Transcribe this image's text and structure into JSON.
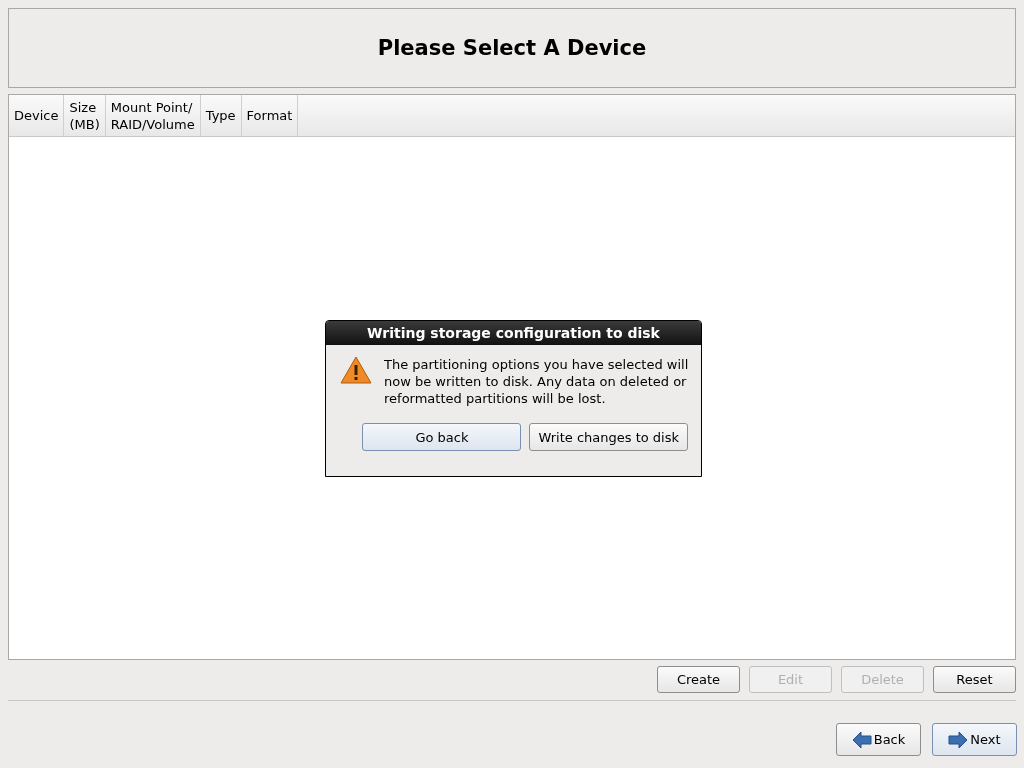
{
  "header": {
    "title": "Please Select A Device"
  },
  "table": {
    "columns": [
      {
        "label": "Device"
      },
      {
        "label": "Size\n(MB)"
      },
      {
        "label": "Mount Point/\nRAID/Volume"
      },
      {
        "label": "Type"
      },
      {
        "label": "Format"
      }
    ]
  },
  "dialog": {
    "title": "Writing storage configuration to disk",
    "message": "The partitioning options you have selected will now be written to disk.  Any data on deleted or reformatted partitions will be lost.",
    "buttons": [
      {
        "label": "Go back",
        "focused": true
      },
      {
        "label": "Write changes to disk",
        "focused": false
      }
    ]
  },
  "actions": [
    {
      "label": "Create",
      "disabled": false
    },
    {
      "label": "Edit",
      "disabled": true
    },
    {
      "label": "Delete",
      "disabled": true
    },
    {
      "label": "Reset",
      "disabled": false
    }
  ],
  "navigation": [
    {
      "label": "Back",
      "kind": "back",
      "focused": false
    },
    {
      "label": "Next",
      "kind": "next",
      "focused": true
    }
  ]
}
